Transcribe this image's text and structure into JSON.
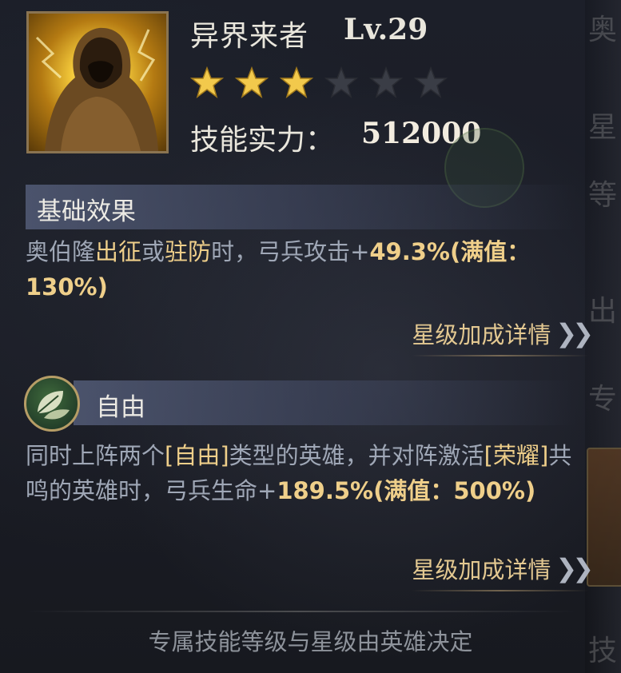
{
  "hero": {
    "name": "异界来者",
    "level": "Lv.29",
    "stars_filled": 3,
    "stars_total": 6,
    "power_label": "技能实力：",
    "power_value": "512000"
  },
  "basic_effect": {
    "title": "基础效果",
    "text_1": "奥伯隆",
    "text_2": "出征",
    "text_3": "或",
    "text_4": "驻防",
    "text_5": "时，弓兵攻击+",
    "value": "49.3%",
    "max_text": "(满值：",
    "max_value": "130%",
    "close": ")",
    "detail_link": "星级加成详情"
  },
  "freedom_effect": {
    "title": "自由",
    "icon": "leaf-icon",
    "text_1": "同时上阵两个",
    "tag_1": "[自由]",
    "text_2": "类型的英雄，并对阵激活",
    "tag_2": "[荣耀]",
    "text_3": "共鸣的英雄时，弓兵生命+",
    "value": "189.5%",
    "max_text": "(满值：",
    "max_value": "500%",
    "close": ")",
    "detail_link": "星级加成详情"
  },
  "footer": "专属技能等级与星级由英雄决定",
  "side_fragments": [
    "奥",
    "星",
    "等",
    "出",
    "专",
    "技"
  ],
  "colors": {
    "star_gold": "#f2c94c",
    "star_dim": "#3a3d46",
    "highlight_gold": "#efcf8a",
    "desc_gray": "#9fa7b6"
  }
}
